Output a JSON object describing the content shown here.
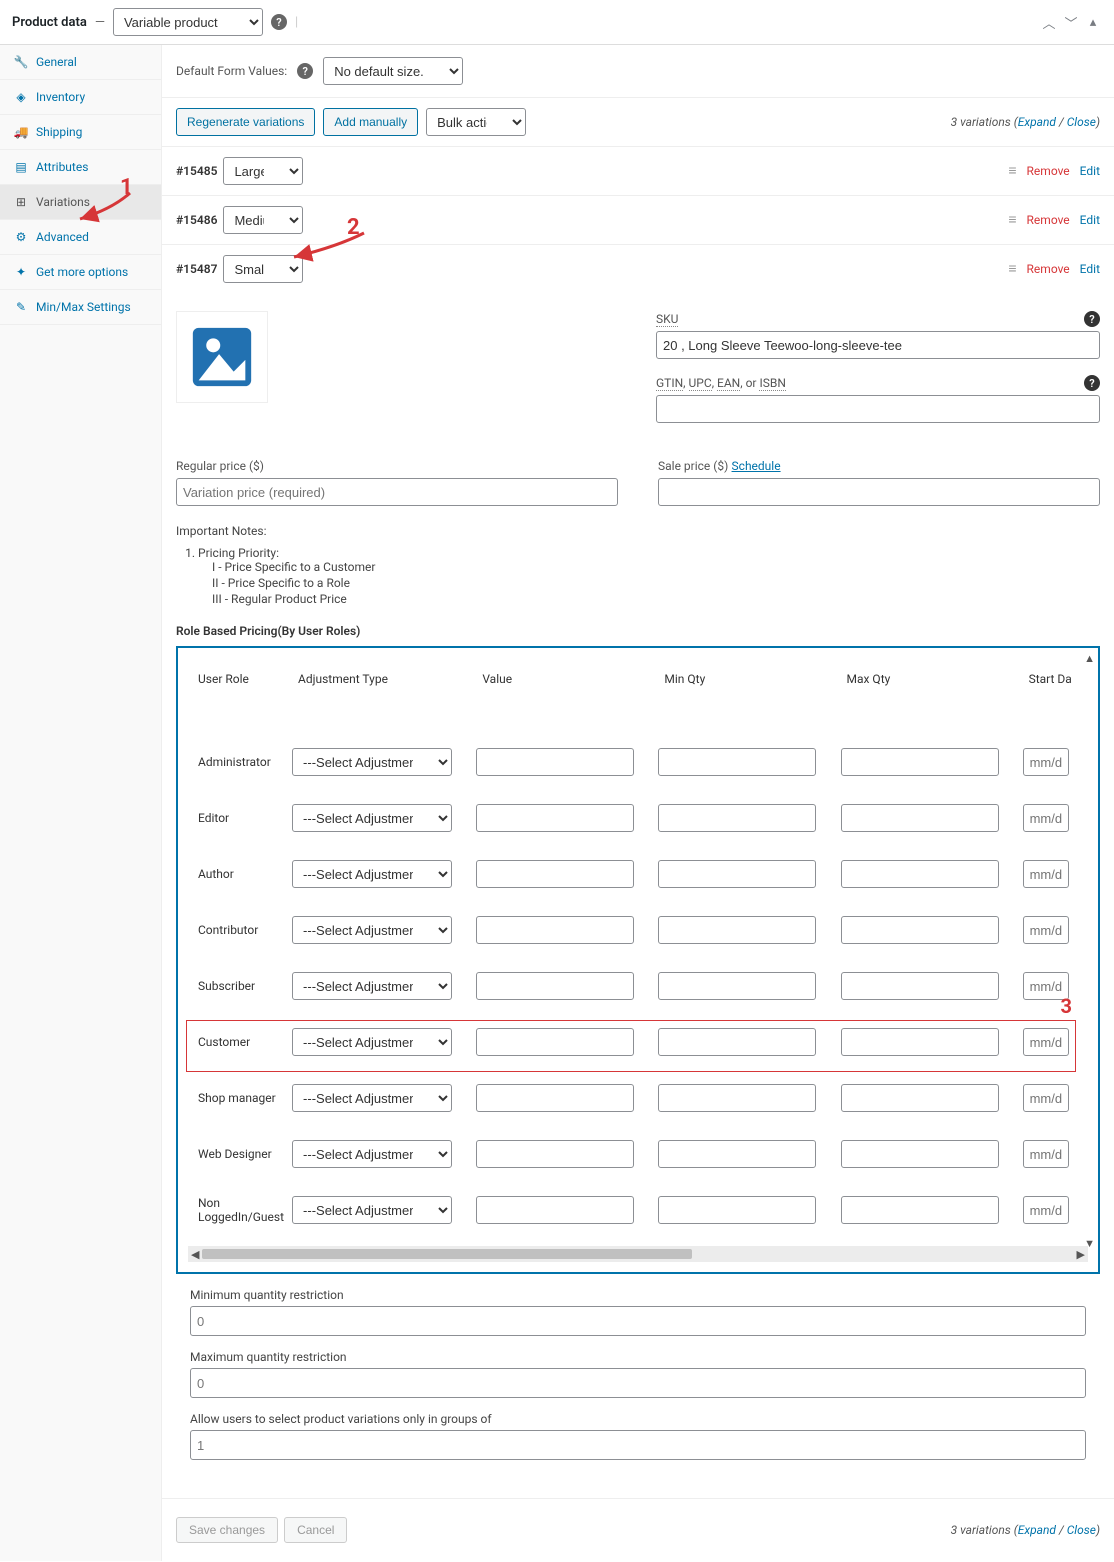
{
  "header": {
    "title": "Product data",
    "separator": "—",
    "product_type": "Variable product"
  },
  "tabs": [
    {
      "key": "general",
      "label": "General",
      "icon": "🔧"
    },
    {
      "key": "inventory",
      "label": "Inventory",
      "icon": "◈"
    },
    {
      "key": "shipping",
      "label": "Shipping",
      "icon": "🚚"
    },
    {
      "key": "attributes",
      "label": "Attributes",
      "icon": "▤"
    },
    {
      "key": "variations",
      "label": "Variations",
      "icon": "⊞"
    },
    {
      "key": "advanced",
      "label": "Advanced",
      "icon": "⚙"
    },
    {
      "key": "get_more",
      "label": "Get more options",
      "icon": "✦"
    },
    {
      "key": "minmax",
      "label": "Min/Max Settings",
      "icon": "✎"
    }
  ],
  "default_values": {
    "label": "Default Form Values:",
    "value": "No default size..."
  },
  "actions": {
    "regenerate": "Regenerate variations",
    "add_manually": "Add manually",
    "bulk": "Bulk actions",
    "summary_count": "3 variations",
    "summary_expand": "Expand",
    "summary_close": "Close",
    "summary_sep": " / "
  },
  "variations": [
    {
      "id": "#15485",
      "size": "Large"
    },
    {
      "id": "#15486",
      "size": "Medium"
    },
    {
      "id": "#15487",
      "size": "Small"
    }
  ],
  "var_actions": {
    "remove": "Remove",
    "edit": "Edit"
  },
  "annotations": {
    "one": "1",
    "two": "2",
    "three": "3"
  },
  "expanded": {
    "sku_label": "SKU",
    "sku_value": "20 , Long Sleeve Teewoo-long-sleeve-tee",
    "gtin_label_parts": [
      "GTIN",
      ", ",
      "UPC",
      ", ",
      "EAN",
      ", or ",
      "ISBN"
    ],
    "gtin_value": "",
    "regular_price_label": "Regular price ($)",
    "regular_price_placeholder": "Variation price (required)",
    "sale_price_label": "Sale price ($)",
    "schedule": "Schedule",
    "notes_title": "Important Notes:",
    "notes_item1": "Pricing Priority:",
    "notes_sub1": "I - Price Specific to a Customer",
    "notes_sub2": "II - Price Specific to a Role",
    "notes_sub3": "III - Regular Product Price",
    "role_title": "Role Based Pricing(By User Roles)",
    "table_headers": [
      "User Role",
      "Adjustment Type",
      "Value",
      "Min Qty",
      "Max Qty",
      "Start Da"
    ],
    "roles": [
      "Administrator",
      "Editor",
      "Author",
      "Contributor",
      "Subscriber",
      "Customer",
      "Shop manager",
      "Web Designer",
      "Non LoggedIn/Guest"
    ],
    "adj_placeholder": "---Select Adjustment Type---",
    "date_placeholder": "mm/d",
    "min_qty_label": "Minimum quantity restriction",
    "min_qty_value": "0",
    "max_qty_label": "Maximum quantity restriction",
    "max_qty_value": "0",
    "groups_label": "Allow users to select product variations only in groups of",
    "groups_value": "1"
  },
  "save": {
    "save": "Save changes",
    "cancel": "Cancel"
  }
}
